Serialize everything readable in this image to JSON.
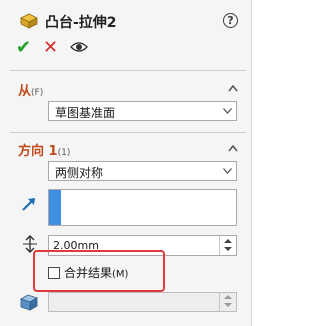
{
  "header": {
    "title": "凸台-拉伸2",
    "help_glyph": "?"
  },
  "actions": {
    "ok_glyph": "✔",
    "cancel_glyph": "✕"
  },
  "from_section": {
    "label": "从",
    "hint": "(F)",
    "dropdown_value": "草图基准面"
  },
  "direction_section": {
    "label": "方向 1",
    "hint": "(1)",
    "end_condition_value": "两侧对称",
    "depth_value": "2.00mm"
  },
  "merge": {
    "label": "合并结果",
    "hint": "(M)",
    "checked": false
  },
  "colors": {
    "section_label": "#c04a1a",
    "ok": "#1fa12a",
    "cancel": "#d92b2b",
    "selection_accent": "#3e8fe0",
    "highlight": "#e03a3a"
  }
}
